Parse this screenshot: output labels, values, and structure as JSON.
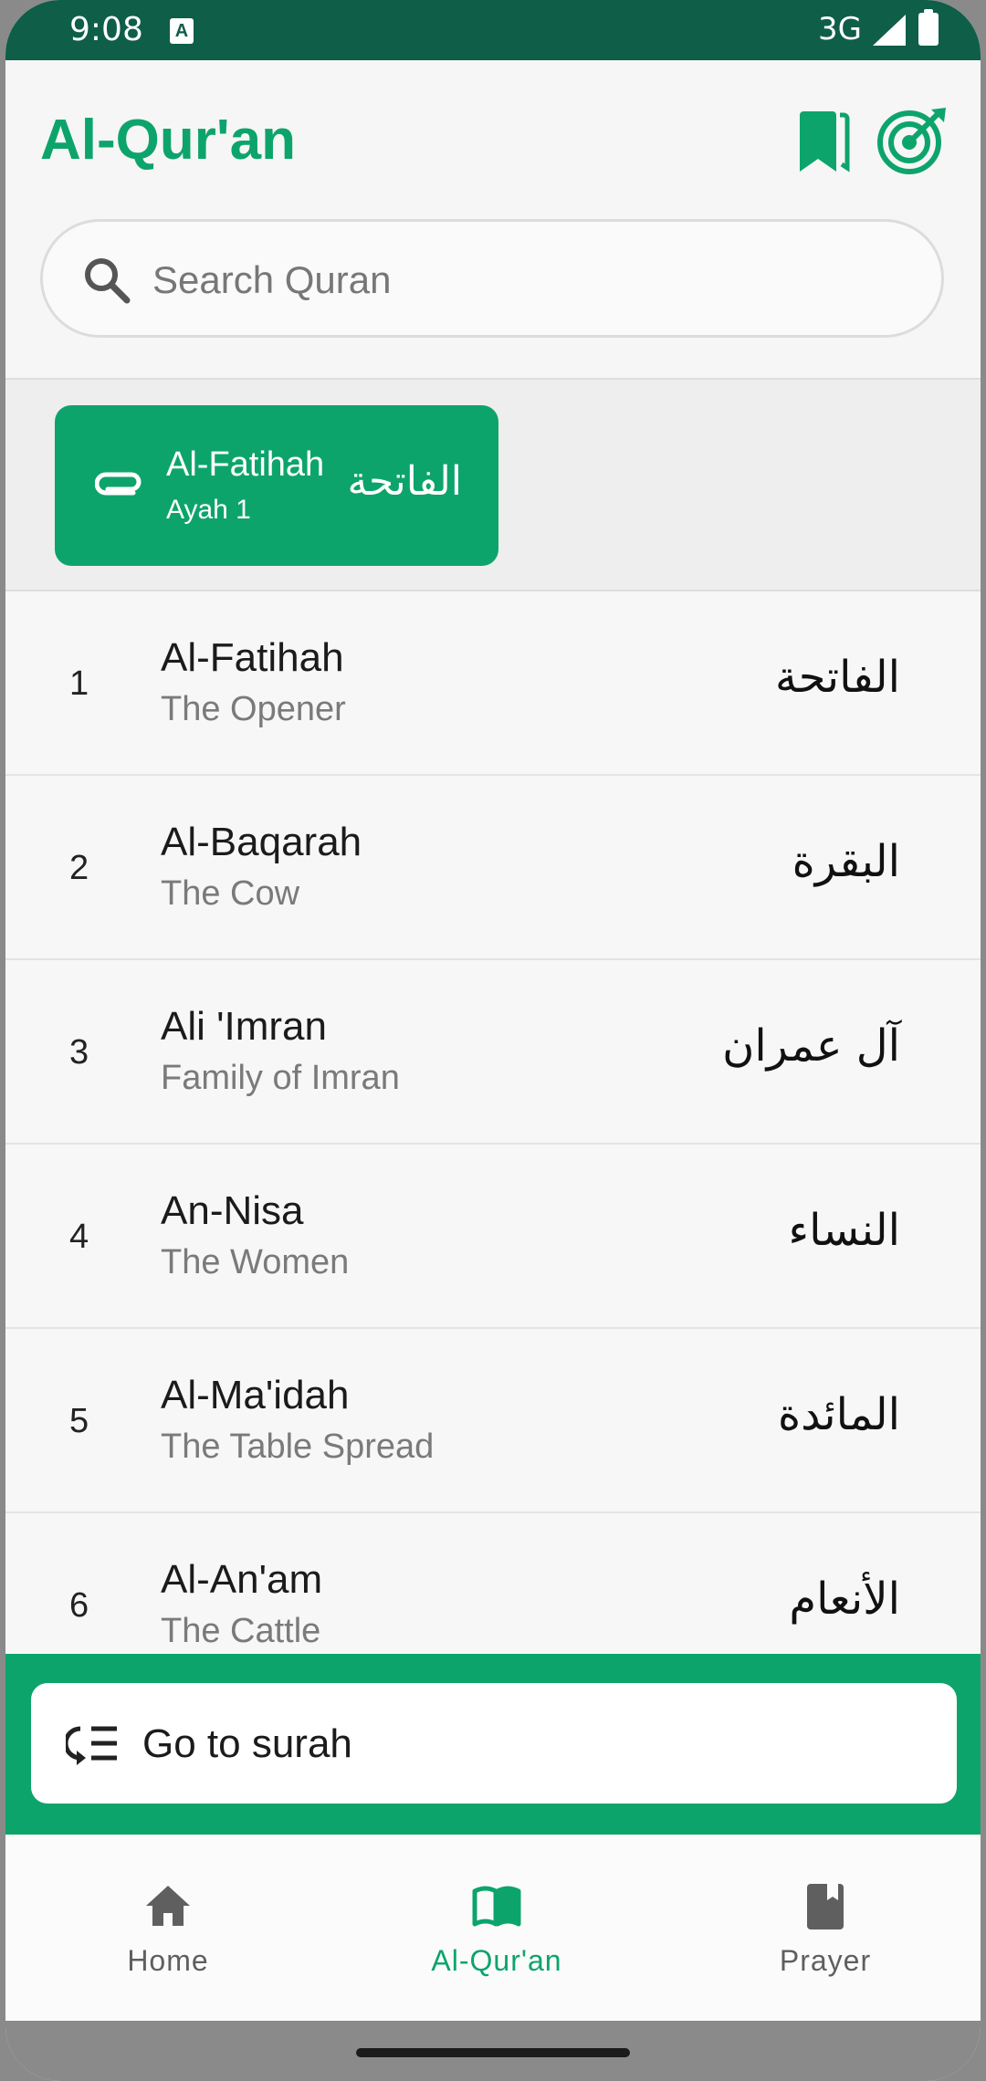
{
  "status_bar": {
    "time": "9:08",
    "network": "3G",
    "a_badge": "A"
  },
  "header": {
    "title": "Al-Qur'an",
    "bookmark_icon": "bookmark-icon",
    "target_icon": "target-icon"
  },
  "search": {
    "placeholder": "Search Quran",
    "value": ""
  },
  "last_read": {
    "name": "Al-Fatihah",
    "ayah": "Ayah 1",
    "arabic": "الفاتحة"
  },
  "surahs": [
    {
      "number": "1",
      "name": "Al-Fatihah",
      "translation": "The Opener",
      "arabic": "الفاتحة"
    },
    {
      "number": "2",
      "name": "Al-Baqarah",
      "translation": "The Cow",
      "arabic": "البقرة"
    },
    {
      "number": "3",
      "name": "Ali 'Imran",
      "translation": "Family of Imran",
      "arabic": "آل عمران"
    },
    {
      "number": "4",
      "name": "An-Nisa",
      "translation": "The Women",
      "arabic": "النساء"
    },
    {
      "number": "5",
      "name": "Al-Ma'idah",
      "translation": "The Table Spread",
      "arabic": "المائدة"
    },
    {
      "number": "6",
      "name": "Al-An'am",
      "translation": "The Cattle",
      "arabic": "الأنعام"
    }
  ],
  "goto": {
    "label": "Go to surah"
  },
  "nav": {
    "home": "Home",
    "quran": "Al-Qur'an",
    "prayer": "Prayer",
    "active": "quran"
  },
  "colors": {
    "primary": "#0da46c",
    "status_bar": "#0e5e48"
  }
}
